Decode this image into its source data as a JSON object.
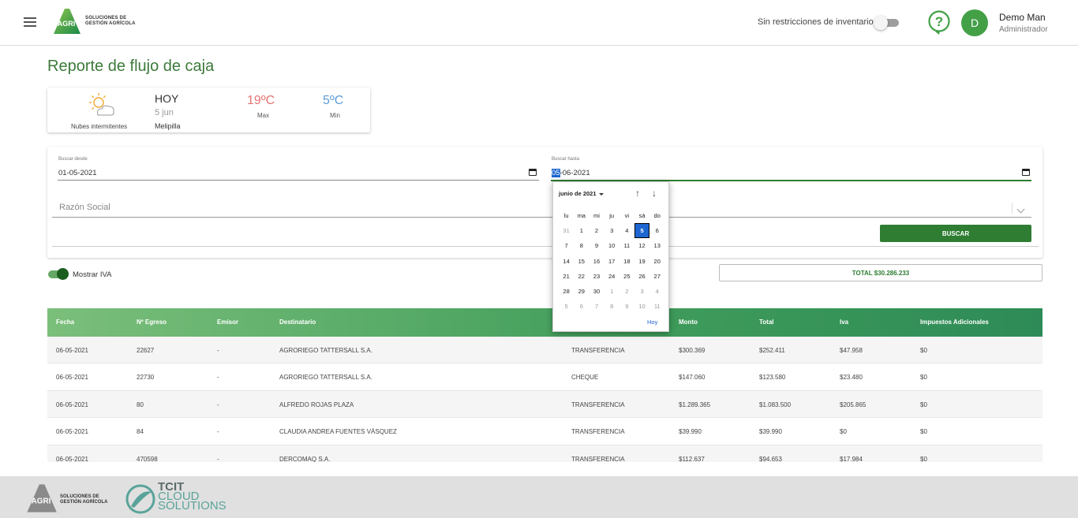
{
  "header": {
    "logo_badge": "AGRI",
    "logo_text_line1": "SOLUCIONES DE",
    "logo_text_line2": "GESTIÓN AGRÍCOLA",
    "inventory_label": "Sin restricciones de inventario",
    "inventory_toggle_on": false,
    "user_initial": "D",
    "user_name": "Demo Man",
    "user_role": "Administrador"
  },
  "page": {
    "title": "Reporte de flujo de caja"
  },
  "weather": {
    "description": "Nubes intermitentes",
    "today": "HOY",
    "date": "5 jun",
    "city": "Melipilla",
    "max": "19ºC",
    "max_label": "Max",
    "min": "5ºC",
    "min_label": "Min"
  },
  "filters": {
    "desde_label": "Buscar desde",
    "desde_value": "01-05-2021",
    "hasta_label": "Buscar hasta",
    "hasta_day": "05",
    "hasta_rest": "-06-2021",
    "razon_placeholder": "Razón Social",
    "buscar_label": "BUSCAR"
  },
  "iva": {
    "label": "Mostrar IVA",
    "on": true
  },
  "total": {
    "label": "TOTAL $30.286.233"
  },
  "table": {
    "headers": {
      "fecha": "Fecha",
      "egreso": "Nº Egreso",
      "emisor": "Emisor",
      "destinatario": "Destinatario",
      "monto": "Monto",
      "total": "Total",
      "iva": "Iva",
      "impuestos": "Impuestos Adicionales"
    },
    "rows": [
      {
        "fecha": "06-05-2021",
        "egreso": "22627",
        "emisor": "-",
        "destinatario": "AGRORIEGO TATTERSALL S.A.",
        "medio": "TRANSFERENCIA",
        "monto": "$300.369",
        "total": "$252.411",
        "iva": "$47.958",
        "impuestos": "$0"
      },
      {
        "fecha": "06-05-2021",
        "egreso": "22730",
        "emisor": "-",
        "destinatario": "AGRORIEGO TATTERSALL S.A.",
        "medio": "CHEQUE",
        "monto": "$147.060",
        "total": "$123.580",
        "iva": "$23.480",
        "impuestos": "$0"
      },
      {
        "fecha": "06-05-2021",
        "egreso": "80",
        "emisor": "-",
        "destinatario": "ALFREDO ROJAS PLAZA",
        "medio": "TRANSFERENCIA",
        "monto": "$1.289.365",
        "total": "$1.083.500",
        "iva": "$205.865",
        "impuestos": "$0"
      },
      {
        "fecha": "06-05-2021",
        "egreso": "84",
        "emisor": "-",
        "destinatario": "CLAUDIA ANDREA FUENTES VÁSQUEZ",
        "medio": "TRANSFERENCIA",
        "monto": "$39.990",
        "total": "$39.990",
        "iva": "$0",
        "impuestos": "$0"
      },
      {
        "fecha": "06-05-2021",
        "egreso": "470598",
        "emisor": "-",
        "destinatario": "DERCOMAQ S.A.",
        "medio": "TRANSFERENCIA",
        "monto": "$112.637",
        "total": "$94.653",
        "iva": "$17.984",
        "impuestos": "$0"
      }
    ]
  },
  "calendar": {
    "month_label": "junio de 2021",
    "up_arrow": "↑",
    "down_arrow": "↓",
    "weekdays": [
      "lu",
      "ma",
      "mi",
      "ju",
      "vi",
      "sá",
      "do"
    ],
    "days": [
      {
        "d": "31",
        "other": true
      },
      {
        "d": "1"
      },
      {
        "d": "2"
      },
      {
        "d": "3"
      },
      {
        "d": "4"
      },
      {
        "d": "5",
        "sel": true
      },
      {
        "d": "6"
      },
      {
        "d": "7"
      },
      {
        "d": "8"
      },
      {
        "d": "9"
      },
      {
        "d": "10"
      },
      {
        "d": "11"
      },
      {
        "d": "12"
      },
      {
        "d": "13"
      },
      {
        "d": "14"
      },
      {
        "d": "15"
      },
      {
        "d": "16"
      },
      {
        "d": "17"
      },
      {
        "d": "18"
      },
      {
        "d": "19"
      },
      {
        "d": "20"
      },
      {
        "d": "21"
      },
      {
        "d": "22"
      },
      {
        "d": "23"
      },
      {
        "d": "24"
      },
      {
        "d": "25"
      },
      {
        "d": "26"
      },
      {
        "d": "27"
      },
      {
        "d": "28"
      },
      {
        "d": "29"
      },
      {
        "d": "30"
      },
      {
        "d": "1",
        "other": true
      },
      {
        "d": "2",
        "other": true
      },
      {
        "d": "3",
        "other": true
      },
      {
        "d": "4",
        "other": true
      },
      {
        "d": "5",
        "other": true
      },
      {
        "d": "6",
        "other": true
      },
      {
        "d": "7",
        "other": true
      },
      {
        "d": "8",
        "other": true
      },
      {
        "d": "9",
        "other": true
      },
      {
        "d": "10",
        "other": true
      },
      {
        "d": "11",
        "other": true
      }
    ],
    "today_label": "Hoy"
  },
  "footer": {
    "agri_badge": "AGRI",
    "agri_line1": "SOLUCIONES DE",
    "agri_line2": "GESTIÓN AGRÍCOLA",
    "tcit_line1": "TCIT",
    "tcit_line2": "CLOUD",
    "tcit_line3": "SOLUTIONS"
  },
  "colors": {
    "brand_green": "#2e7d32",
    "title_green": "#3d7a3a",
    "max_temp": "#e57373",
    "min_temp": "#5c9dd6",
    "selection_blue": "#1e66d0"
  }
}
